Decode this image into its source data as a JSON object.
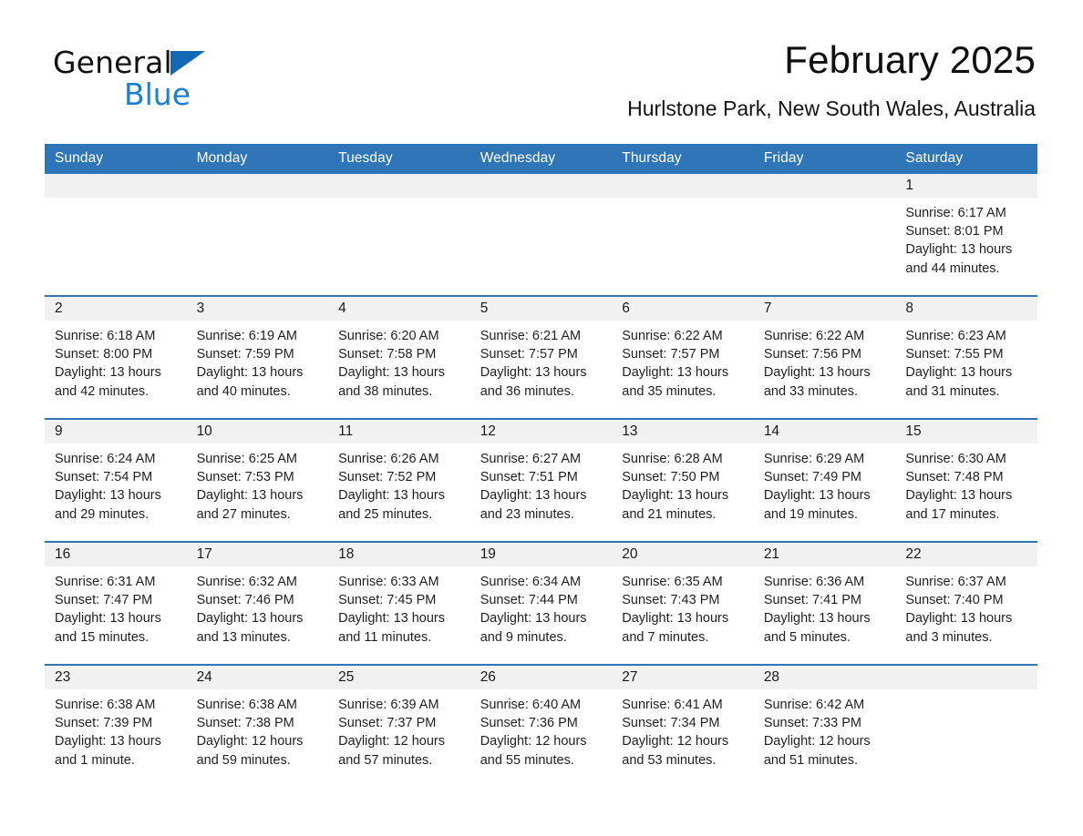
{
  "brand": {
    "word1": "General",
    "word2": "Blue",
    "triangle_icon": "blue-triangle",
    "color_primary": "#1268b3",
    "color_secondary": "#1b7fd4"
  },
  "header": {
    "title": "February 2025",
    "location": "Hurlstone Park, New South Wales, Australia"
  },
  "calendar": {
    "accent_color": "#2e76b8",
    "daynum_band_color": "#f1f1f1",
    "weekday_headers": [
      "Sunday",
      "Monday",
      "Tuesday",
      "Wednesday",
      "Thursday",
      "Friday",
      "Saturday"
    ],
    "weeks": [
      [
        {
          "day": "",
          "lines": []
        },
        {
          "day": "",
          "lines": []
        },
        {
          "day": "",
          "lines": []
        },
        {
          "day": "",
          "lines": []
        },
        {
          "day": "",
          "lines": []
        },
        {
          "day": "",
          "lines": []
        },
        {
          "day": "1",
          "lines": [
            "Sunrise: 6:17 AM",
            "Sunset: 8:01 PM",
            "Daylight: 13 hours",
            "and 44 minutes."
          ]
        }
      ],
      [
        {
          "day": "2",
          "lines": [
            "Sunrise: 6:18 AM",
            "Sunset: 8:00 PM",
            "Daylight: 13 hours",
            "and 42 minutes."
          ]
        },
        {
          "day": "3",
          "lines": [
            "Sunrise: 6:19 AM",
            "Sunset: 7:59 PM",
            "Daylight: 13 hours",
            "and 40 minutes."
          ]
        },
        {
          "day": "4",
          "lines": [
            "Sunrise: 6:20 AM",
            "Sunset: 7:58 PM",
            "Daylight: 13 hours",
            "and 38 minutes."
          ]
        },
        {
          "day": "5",
          "lines": [
            "Sunrise: 6:21 AM",
            "Sunset: 7:57 PM",
            "Daylight: 13 hours",
            "and 36 minutes."
          ]
        },
        {
          "day": "6",
          "lines": [
            "Sunrise: 6:22 AM",
            "Sunset: 7:57 PM",
            "Daylight: 13 hours",
            "and 35 minutes."
          ]
        },
        {
          "day": "7",
          "lines": [
            "Sunrise: 6:22 AM",
            "Sunset: 7:56 PM",
            "Daylight: 13 hours",
            "and 33 minutes."
          ]
        },
        {
          "day": "8",
          "lines": [
            "Sunrise: 6:23 AM",
            "Sunset: 7:55 PM",
            "Daylight: 13 hours",
            "and 31 minutes."
          ]
        }
      ],
      [
        {
          "day": "9",
          "lines": [
            "Sunrise: 6:24 AM",
            "Sunset: 7:54 PM",
            "Daylight: 13 hours",
            "and 29 minutes."
          ]
        },
        {
          "day": "10",
          "lines": [
            "Sunrise: 6:25 AM",
            "Sunset: 7:53 PM",
            "Daylight: 13 hours",
            "and 27 minutes."
          ]
        },
        {
          "day": "11",
          "lines": [
            "Sunrise: 6:26 AM",
            "Sunset: 7:52 PM",
            "Daylight: 13 hours",
            "and 25 minutes."
          ]
        },
        {
          "day": "12",
          "lines": [
            "Sunrise: 6:27 AM",
            "Sunset: 7:51 PM",
            "Daylight: 13 hours",
            "and 23 minutes."
          ]
        },
        {
          "day": "13",
          "lines": [
            "Sunrise: 6:28 AM",
            "Sunset: 7:50 PM",
            "Daylight: 13 hours",
            "and 21 minutes."
          ]
        },
        {
          "day": "14",
          "lines": [
            "Sunrise: 6:29 AM",
            "Sunset: 7:49 PM",
            "Daylight: 13 hours",
            "and 19 minutes."
          ]
        },
        {
          "day": "15",
          "lines": [
            "Sunrise: 6:30 AM",
            "Sunset: 7:48 PM",
            "Daylight: 13 hours",
            "and 17 minutes."
          ]
        }
      ],
      [
        {
          "day": "16",
          "lines": [
            "Sunrise: 6:31 AM",
            "Sunset: 7:47 PM",
            "Daylight: 13 hours",
            "and 15 minutes."
          ]
        },
        {
          "day": "17",
          "lines": [
            "Sunrise: 6:32 AM",
            "Sunset: 7:46 PM",
            "Daylight: 13 hours",
            "and 13 minutes."
          ]
        },
        {
          "day": "18",
          "lines": [
            "Sunrise: 6:33 AM",
            "Sunset: 7:45 PM",
            "Daylight: 13 hours",
            "and 11 minutes."
          ]
        },
        {
          "day": "19",
          "lines": [
            "Sunrise: 6:34 AM",
            "Sunset: 7:44 PM",
            "Daylight: 13 hours",
            "and 9 minutes."
          ]
        },
        {
          "day": "20",
          "lines": [
            "Sunrise: 6:35 AM",
            "Sunset: 7:43 PM",
            "Daylight: 13 hours",
            "and 7 minutes."
          ]
        },
        {
          "day": "21",
          "lines": [
            "Sunrise: 6:36 AM",
            "Sunset: 7:41 PM",
            "Daylight: 13 hours",
            "and 5 minutes."
          ]
        },
        {
          "day": "22",
          "lines": [
            "Sunrise: 6:37 AM",
            "Sunset: 7:40 PM",
            "Daylight: 13 hours",
            "and 3 minutes."
          ]
        }
      ],
      [
        {
          "day": "23",
          "lines": [
            "Sunrise: 6:38 AM",
            "Sunset: 7:39 PM",
            "Daylight: 13 hours",
            "and 1 minute."
          ]
        },
        {
          "day": "24",
          "lines": [
            "Sunrise: 6:38 AM",
            "Sunset: 7:38 PM",
            "Daylight: 12 hours",
            "and 59 minutes."
          ]
        },
        {
          "day": "25",
          "lines": [
            "Sunrise: 6:39 AM",
            "Sunset: 7:37 PM",
            "Daylight: 12 hours",
            "and 57 minutes."
          ]
        },
        {
          "day": "26",
          "lines": [
            "Sunrise: 6:40 AM",
            "Sunset: 7:36 PM",
            "Daylight: 12 hours",
            "and 55 minutes."
          ]
        },
        {
          "day": "27",
          "lines": [
            "Sunrise: 6:41 AM",
            "Sunset: 7:34 PM",
            "Daylight: 12 hours",
            "and 53 minutes."
          ]
        },
        {
          "day": "28",
          "lines": [
            "Sunrise: 6:42 AM",
            "Sunset: 7:33 PM",
            "Daylight: 12 hours",
            "and 51 minutes."
          ]
        },
        {
          "day": "",
          "lines": []
        }
      ]
    ]
  }
}
